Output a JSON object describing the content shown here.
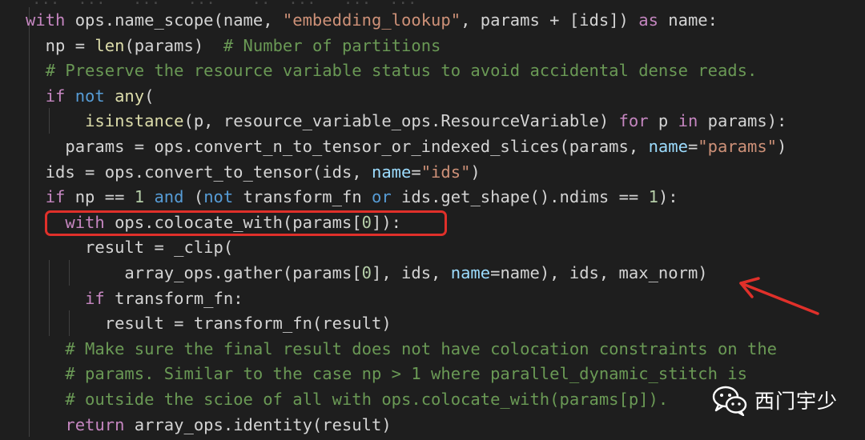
{
  "colors": {
    "background": "#1e1e1e",
    "keyword": "#c586c0",
    "control": "#569cd6",
    "function": "#dcdcaa",
    "string": "#ce9178",
    "comment": "#6a9955",
    "number": "#b5cea8",
    "parameter": "#9cdcfe",
    "plain": "#d4d4d4",
    "highlight": "#e0302a"
  },
  "editor": {
    "partial_top_text": "...  ...   ...   ...    .:  ...   ...  ...",
    "lines": [
      [
        [
          "with",
          "k"
        ],
        [
          " ops.name_scope(name, ",
          "p"
        ],
        [
          "\"embedding_lookup\"",
          "s"
        ],
        [
          ", params + [ids]) ",
          "p"
        ],
        [
          "as",
          "k"
        ],
        [
          " name:",
          "p"
        ]
      ],
      [
        [
          "  np = ",
          "p"
        ],
        [
          "len",
          "f"
        ],
        [
          "(params)  ",
          "p"
        ],
        [
          "# Number of partitions",
          "c"
        ]
      ],
      [
        [
          "  ",
          "p"
        ],
        [
          "# Preserve the resource variable status to avoid accidental dense reads.",
          "c"
        ]
      ],
      [
        [
          "  ",
          "p"
        ],
        [
          "if",
          "k"
        ],
        [
          " ",
          "p"
        ],
        [
          "not",
          "b"
        ],
        [
          " ",
          "p"
        ],
        [
          "any",
          "f"
        ],
        [
          "(",
          "p"
        ]
      ],
      [
        [
          "      ",
          "p"
        ],
        [
          "isinstance",
          "f"
        ],
        [
          "(p, resource_variable_ops.ResourceVariable) ",
          "p"
        ],
        [
          "for",
          "k"
        ],
        [
          " p ",
          "p"
        ],
        [
          "in",
          "k"
        ],
        [
          " params):",
          "p"
        ]
      ],
      [
        [
          "    params = ops.convert_n_to_tensor_or_indexed_slices(params, ",
          "p"
        ],
        [
          "name",
          "v"
        ],
        [
          "=",
          "p"
        ],
        [
          "\"params\"",
          "s"
        ],
        [
          ")",
          "p"
        ]
      ],
      [
        [
          "  ids = ops.convert_to_tensor(ids, ",
          "p"
        ],
        [
          "name",
          "v"
        ],
        [
          "=",
          "p"
        ],
        [
          "\"ids\"",
          "s"
        ],
        [
          ")",
          "p"
        ]
      ],
      [
        [
          "  ",
          "p"
        ],
        [
          "if",
          "k"
        ],
        [
          " np == ",
          "p"
        ],
        [
          "1",
          "n"
        ],
        [
          " ",
          "p"
        ],
        [
          "and",
          "b"
        ],
        [
          " (",
          "p"
        ],
        [
          "not",
          "b"
        ],
        [
          " transform_fn ",
          "p"
        ],
        [
          "or",
          "b"
        ],
        [
          " ids.get_shape().ndims == ",
          "p"
        ],
        [
          "1",
          "n"
        ],
        [
          "):",
          "p"
        ]
      ],
      [
        [
          "    ",
          "p"
        ],
        [
          "with",
          "k"
        ],
        [
          " ops.colocate_with(params[",
          "p"
        ],
        [
          "0",
          "n"
        ],
        [
          "]):",
          "p"
        ]
      ],
      [
        [
          "      result = _clip(",
          "p"
        ]
      ],
      [
        [
          "          array_ops.gather(params[",
          "p"
        ],
        [
          "0",
          "n"
        ],
        [
          "], ids, ",
          "p"
        ],
        [
          "name",
          "v"
        ],
        [
          "=name), ids, max_norm)",
          "p"
        ]
      ],
      [
        [
          "      ",
          "p"
        ],
        [
          "if",
          "k"
        ],
        [
          " transform_fn:",
          "p"
        ]
      ],
      [
        [
          "        result = transform_fn(result)",
          "p"
        ]
      ],
      [
        [
          "    ",
          "p"
        ],
        [
          "# Make sure the final result does not have colocation constraints on the",
          "c"
        ]
      ],
      [
        [
          "    ",
          "p"
        ],
        [
          "# params. Similar to the case np > 1 where parallel_dynamic_stitch is",
          "c"
        ]
      ],
      [
        [
          "    ",
          "p"
        ],
        [
          "# outside the scioe of all with ops.colocate_with(params[p]).",
          "c"
        ]
      ],
      [
        [
          "    ",
          "p"
        ],
        [
          "return",
          "k"
        ],
        [
          " array_ops.identity(result)",
          "p"
        ]
      ]
    ]
  },
  "annotations": {
    "highlight_box": "red rounded rectangle around line 9",
    "arrow": "red-arrow"
  },
  "watermark": {
    "icon": "wechat-icon",
    "text": "西门宇少"
  }
}
